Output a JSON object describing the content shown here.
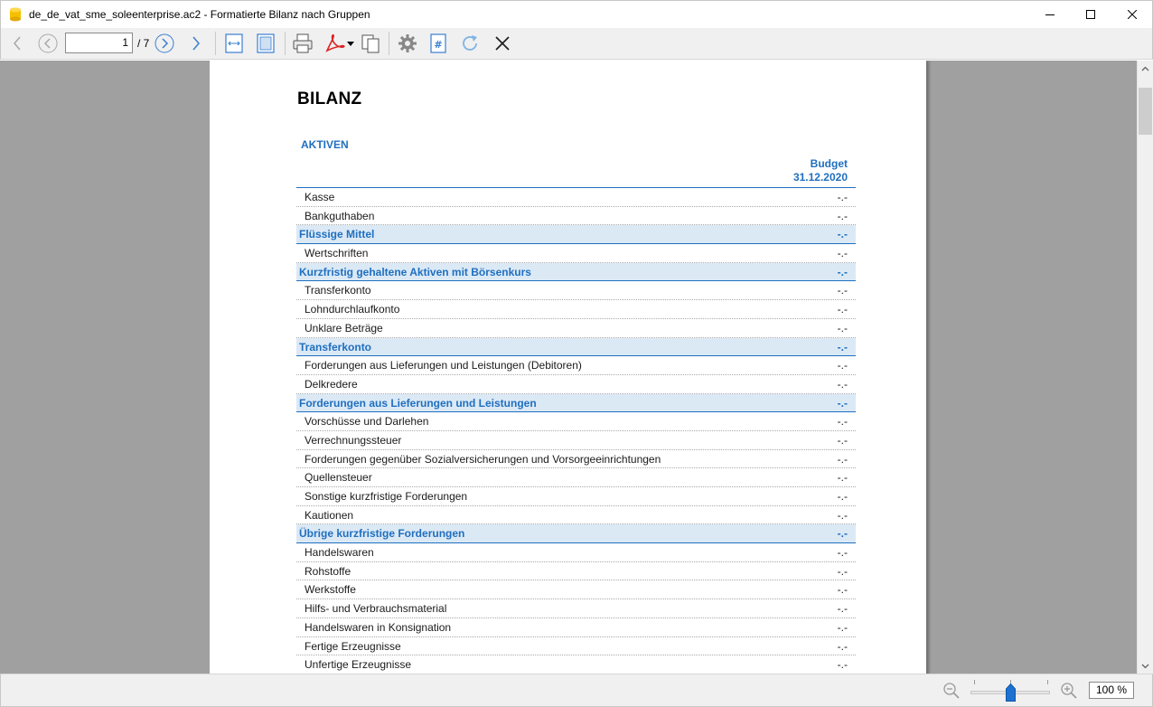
{
  "window": {
    "title": "de_de_vat_sme_soleenterprise.ac2 - Formatierte Bilanz nach Gruppen"
  },
  "toolbar": {
    "page_current": "1",
    "page_total": "/ 7",
    "icons": [
      "back-icon",
      "prev-page-icon",
      "next-page-icon",
      "forward-icon",
      "fit-width-icon",
      "fit-page-icon",
      "print-icon",
      "pdf-icon",
      "copy-icon",
      "settings-icon",
      "page-number-icon",
      "refresh-icon",
      "close-icon"
    ]
  },
  "document": {
    "title": "BILANZ",
    "section": "AKTIVEN",
    "column_header_line1": "Budget",
    "column_header_line2": "31.12.2020",
    "rows": [
      {
        "label": "Kasse",
        "value": "-.-",
        "type": "item"
      },
      {
        "label": "Bankguthaben",
        "value": "-.-",
        "type": "item"
      },
      {
        "label": "Flüssige Mittel",
        "value": "-.-",
        "type": "group"
      },
      {
        "label": "Wertschriften",
        "value": "-.-",
        "type": "item"
      },
      {
        "label": "Kurzfristig gehaltene Aktiven mit Börsenkurs",
        "value": "-.-",
        "type": "group"
      },
      {
        "label": "Transferkonto",
        "value": "-.-",
        "type": "item"
      },
      {
        "label": "Lohndurchlaufkonto",
        "value": "-.-",
        "type": "item"
      },
      {
        "label": "Unklare Beträge",
        "value": "-.-",
        "type": "item"
      },
      {
        "label": "Transferkonto",
        "value": "-.-",
        "type": "group"
      },
      {
        "label": "Forderungen aus Lieferungen und Leistungen (Debitoren)",
        "value": "-.-",
        "type": "item"
      },
      {
        "label": "Delkredere",
        "value": "-.-",
        "type": "item"
      },
      {
        "label": "Forderungen aus Lieferungen und Leistungen",
        "value": "-.-",
        "type": "group"
      },
      {
        "label": "Vorschüsse und Darlehen",
        "value": "-.-",
        "type": "item"
      },
      {
        "label": "Verrechnungssteuer",
        "value": "-.-",
        "type": "item"
      },
      {
        "label": "Forderungen gegenüber Sozialversicherungen und Vorsorgeeinrichtungen",
        "value": "-.-",
        "type": "item"
      },
      {
        "label": "Quellensteuer",
        "value": "-.-",
        "type": "item"
      },
      {
        "label": "Sonstige kurzfristige Forderungen",
        "value": "-.-",
        "type": "item"
      },
      {
        "label": "Kautionen",
        "value": "-.-",
        "type": "item"
      },
      {
        "label": "Übrige kurzfristige Forderungen",
        "value": "-.-",
        "type": "group"
      },
      {
        "label": "Handelswaren",
        "value": "-.-",
        "type": "item"
      },
      {
        "label": "Rohstoffe",
        "value": "-.-",
        "type": "item"
      },
      {
        "label": "Werkstoffe",
        "value": "-.-",
        "type": "item"
      },
      {
        "label": "Hilfs- und Verbrauchsmaterial",
        "value": "-.-",
        "type": "item"
      },
      {
        "label": "Handelswaren in Konsignation",
        "value": "-.-",
        "type": "item"
      },
      {
        "label": "Fertige Erzeugnisse",
        "value": "-.-",
        "type": "item"
      },
      {
        "label": "Unfertige Erzeugnisse",
        "value": "-.-",
        "type": "item"
      }
    ]
  },
  "statusbar": {
    "zoom": "100 %",
    "zoom_level": 1.0
  },
  "colors": {
    "accent": "#1f6fc0",
    "group_bg": "#dbe9f5",
    "viewport_bg": "#a0a0a0"
  }
}
